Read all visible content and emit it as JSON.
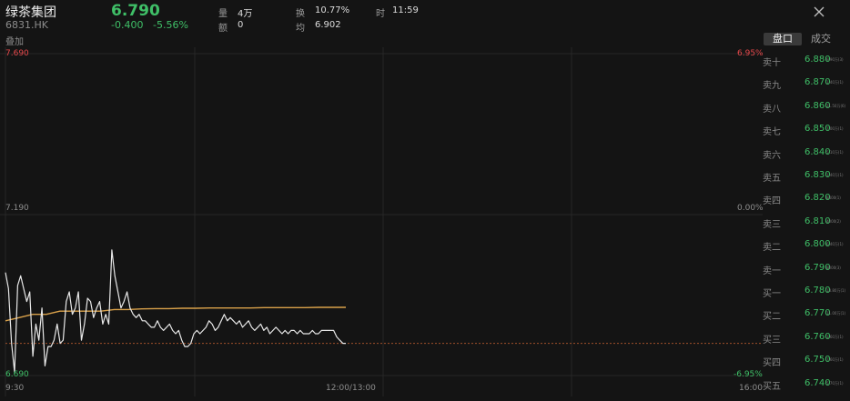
{
  "header": {
    "name": "绿茶集团",
    "code": "6831.HK",
    "overlay": "叠加",
    "price": "6.790",
    "change": "-0.400",
    "change_pct": "-5.56%",
    "stats": [
      {
        "label": "量",
        "value": "4万"
      },
      {
        "label": "额",
        "value": "0"
      },
      {
        "label": "换",
        "value": "10.77%"
      },
      {
        "label": "均",
        "value": "6.902"
      },
      {
        "label": "时",
        "value": "11:59"
      }
    ]
  },
  "tabs": {
    "orderbook": "盘口",
    "trades": "成交"
  },
  "chart_data": {
    "type": "line",
    "high_label": "7.690",
    "mid_label": "7.190",
    "low_label": "6.690",
    "high_pct": "6.95%",
    "mid_pct": "0.00%",
    "low_pct": "-6.95%",
    "x_labels": [
      "9:30",
      "12:00/13:00",
      "16:00"
    ],
    "ylim": [
      6.69,
      7.69
    ],
    "prev_close": 7.19,
    "last_price": 6.79,
    "series": [
      {
        "kind": "price",
        "values": [
          7.01,
          6.96,
          6.79,
          6.7,
          6.97,
          7.0,
          6.96,
          6.92,
          6.95,
          6.75,
          6.85,
          6.8,
          6.9,
          6.72,
          6.78,
          6.78,
          6.8,
          6.85,
          6.79,
          6.8,
          6.92,
          6.95,
          6.88,
          6.9,
          6.95,
          6.8,
          6.85,
          6.93,
          6.92,
          6.87,
          6.9,
          6.92,
          6.85,
          6.88,
          6.85,
          7.08,
          7.0,
          6.95,
          6.9,
          6.92,
          6.95,
          6.9,
          6.88,
          6.87,
          6.88,
          6.86,
          6.86,
          6.85,
          6.84,
          6.84,
          6.86,
          6.84,
          6.83,
          6.84,
          6.85,
          6.83,
          6.82,
          6.83,
          6.8,
          6.78,
          6.78,
          6.79,
          6.82,
          6.83,
          6.82,
          6.83,
          6.84,
          6.86,
          6.85,
          6.83,
          6.84,
          6.86,
          6.88,
          6.86,
          6.87,
          6.86,
          6.85,
          6.86,
          6.84,
          6.85,
          6.86,
          6.84,
          6.83,
          6.84,
          6.85,
          6.83,
          6.84,
          6.82,
          6.83,
          6.84,
          6.83,
          6.82,
          6.83,
          6.82,
          6.83,
          6.83,
          6.82,
          6.83,
          6.82,
          6.82,
          6.82,
          6.83,
          6.82,
          6.82,
          6.83,
          6.83,
          6.83,
          6.83,
          6.83,
          6.81,
          6.8,
          6.79,
          6.79
        ]
      },
      {
        "kind": "average",
        "values": [
          6.86,
          6.87,
          6.88,
          6.88,
          6.89,
          6.89,
          6.89,
          6.89,
          6.895,
          6.895,
          6.897,
          6.898,
          6.898,
          6.899,
          6.899,
          6.9,
          6.9,
          6.9,
          6.9,
          6.901,
          6.901,
          6.901,
          6.901,
          6.902,
          6.902,
          6.902
        ]
      }
    ]
  },
  "orderbook": [
    {
      "label": "卖十",
      "price": "6.880",
      "vol": "9.90万(3)",
      "side": "ask"
    },
    {
      "label": "卖九",
      "price": "6.870",
      "vol": "1.40万(1)",
      "side": "ask"
    },
    {
      "label": "卖八",
      "price": "6.860",
      "vol": "21.50万(6)",
      "side": "ask"
    },
    {
      "label": "卖七",
      "price": "6.850",
      "vol": "7.00万(1)",
      "side": "ask"
    },
    {
      "label": "卖六",
      "price": "6.840",
      "vol": "5.10万(1)",
      "side": "ask"
    },
    {
      "label": "卖五",
      "price": "6.830",
      "vol": "1.40万(1)",
      "side": "ask"
    },
    {
      "label": "卖四",
      "price": "6.820",
      "vol": "8400(1)",
      "side": "ask"
    },
    {
      "label": "卖三",
      "price": "6.810",
      "vol": "4000(2)",
      "side": "ask"
    },
    {
      "label": "卖二",
      "price": "6.800",
      "vol": "6.40万(1)",
      "side": "ask"
    },
    {
      "label": "卖一",
      "price": "6.790",
      "vol": "8000(3)",
      "side": "ask"
    },
    {
      "label": "买一",
      "price": "6.780",
      "vol": "13.80万(1)",
      "side": "bid"
    },
    {
      "label": "买二",
      "price": "6.770",
      "vol": "11.00万(1)",
      "side": "bid"
    },
    {
      "label": "买三",
      "price": "6.760",
      "vol": "3.60万(1)",
      "side": "bid"
    },
    {
      "label": "买四",
      "price": "6.750",
      "vol": "7.60万(1)",
      "side": "bid"
    },
    {
      "label": "买五",
      "price": "6.740",
      "vol": "5.70万(1)",
      "side": "bid"
    }
  ],
  "colors": {
    "up": "#e5474a",
    "down": "#3fbf67",
    "avg_line": "#d9a14a",
    "price_line": "#e8e8e8"
  }
}
